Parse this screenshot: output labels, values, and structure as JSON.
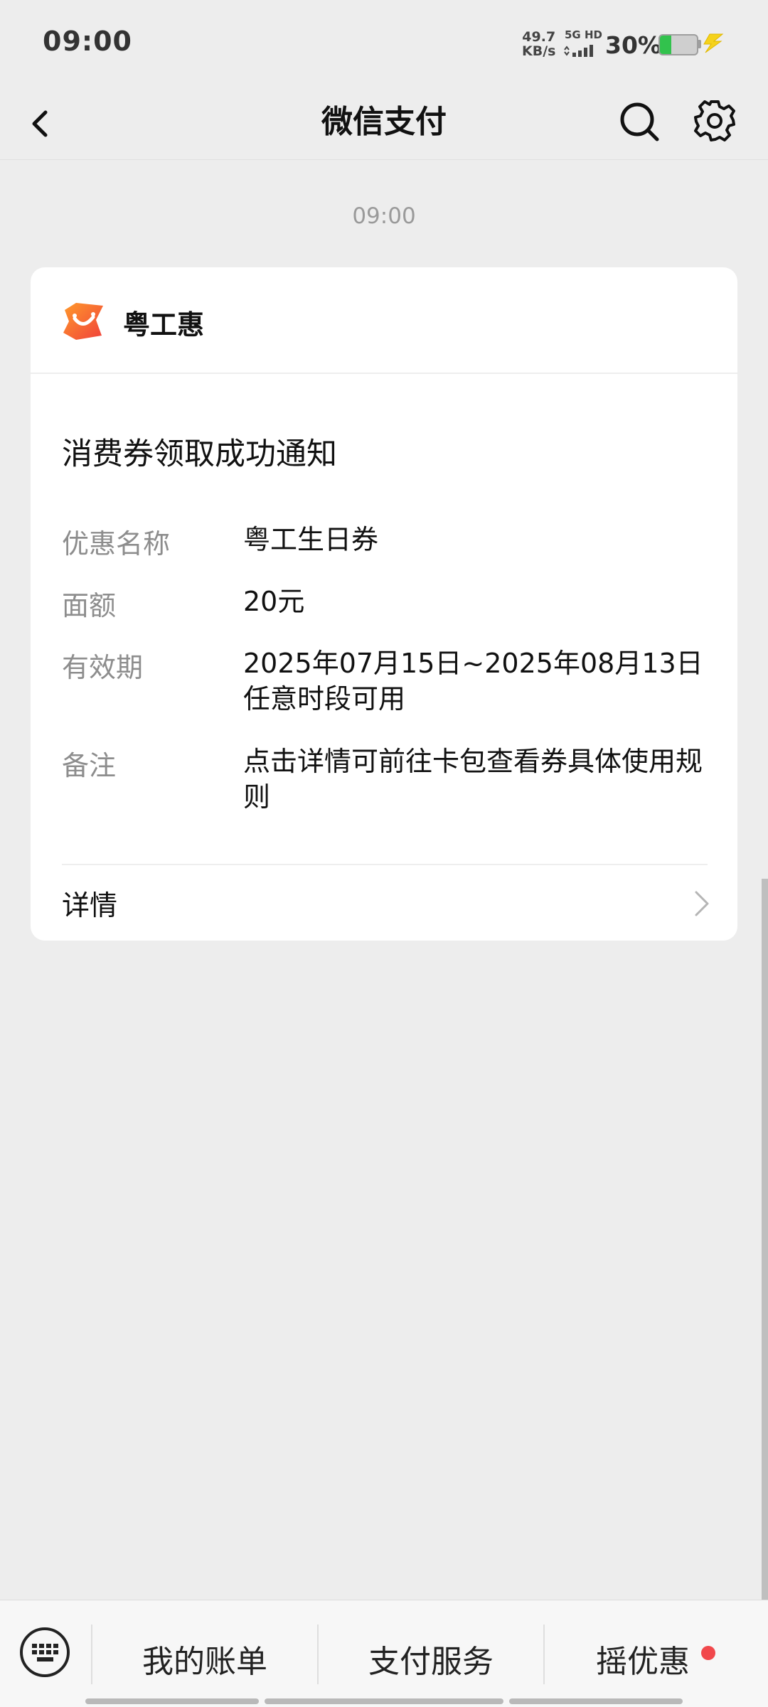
{
  "status_bar": {
    "time": "09:00",
    "net_speed_value": "49.7",
    "net_speed_unit": "KB/s",
    "network_label": "5G HD",
    "battery_percent": "30%",
    "battery_level": 0.3,
    "battery_color": "#32c24d",
    "charging_color": "#f5d21b"
  },
  "navbar": {
    "title": "微信支付",
    "back_icon": "chevron-left-icon",
    "search_icon": "search-icon",
    "settings_icon": "gear-icon"
  },
  "message": {
    "time": "09:00",
    "brand": {
      "name": "粤工惠",
      "logo_colors": [
        "#f0403b",
        "#ff9a2b"
      ]
    },
    "title": "消费券领取成功通知",
    "fields": [
      {
        "label": "优惠名称",
        "value": "粤工生日券"
      },
      {
        "label": "面额",
        "value": "20元"
      },
      {
        "label": "有效期",
        "value": "2025年07月15日~2025年08月13日任意时段可用"
      },
      {
        "label": "备注",
        "value": "点击详情可前往卡包查看券具体使用规则"
      }
    ],
    "detail_label": "详情"
  },
  "bottom_menu": {
    "keyboard_icon": "keyboard-icon",
    "items": [
      {
        "label": "我的账单"
      },
      {
        "label": "支付服务"
      },
      {
        "label": "摇优惠"
      }
    ],
    "badge_color": "#f1484c"
  }
}
